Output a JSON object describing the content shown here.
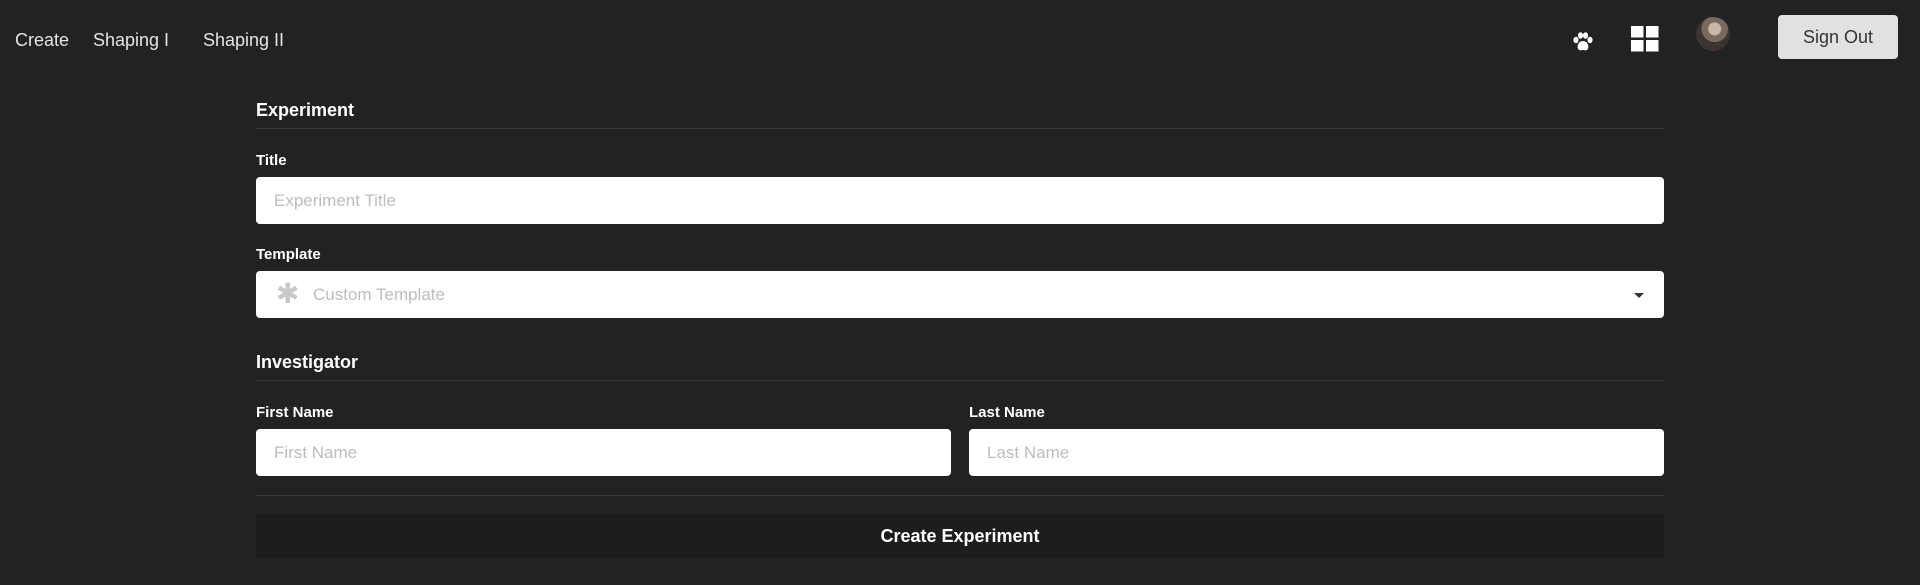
{
  "nav": {
    "links": [
      "Create",
      "Shaping I",
      "Shaping II"
    ],
    "icons": [
      "paw-icon",
      "grid-icon",
      "avatar"
    ],
    "sign_out_label": "Sign Out"
  },
  "experiment_section": {
    "header": "Experiment",
    "title_label": "Title",
    "title_placeholder": "Experiment Title",
    "title_value": "",
    "template_label": "Template",
    "template_selected": "Custom Template"
  },
  "investigator_section": {
    "header": "Investigator",
    "first_name_label": "First Name",
    "first_name_placeholder": "First Name",
    "first_name_value": "",
    "last_name_label": "Last Name",
    "last_name_placeholder": "Last Name",
    "last_name_value": ""
  },
  "submit_label": "Create Experiment",
  "colors": {
    "background": "#222222",
    "input_background": "#ffffff",
    "button_dark": "#1c1d1e",
    "sign_out_button": "#e0e1e2"
  }
}
